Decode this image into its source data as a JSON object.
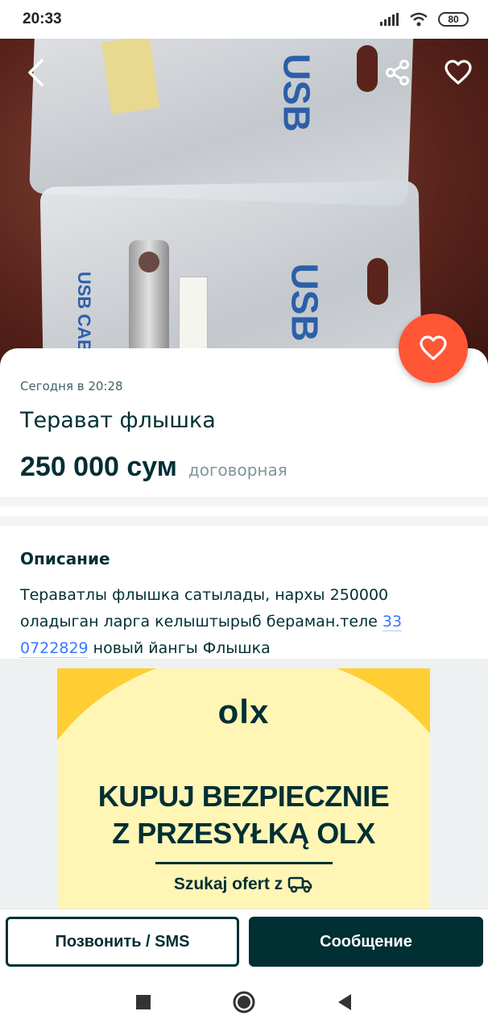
{
  "status_bar": {
    "time": "20:33",
    "battery": "80",
    "icons": [
      "signal-icon",
      "wifi-icon",
      "battery-icon"
    ]
  },
  "photo": {
    "description_icons": [
      "back-arrow-icon",
      "share-icon",
      "heart-outline-icon"
    ],
    "package_text": "USB",
    "package_text_2": "USB CABLE"
  },
  "listing": {
    "posted": "Сегодня в 20:28",
    "title": "Терават флышка",
    "price": "250 000 сум",
    "negotiable": "договорная"
  },
  "description": {
    "heading": "Описание",
    "text_before": "Тераватлы флышка сатылады, нархы 250000 оладыган ларга келыштырыб бераман.теле ",
    "phone": "33 0722829",
    "text_after": " новый йангы Флышка"
  },
  "ad": {
    "logo": "olx",
    "headline_1": "KUPUJ BEZPIECZNIE",
    "headline_2": "Z PRZESYŁKĄ OLX",
    "cta": "Szukaj ofert z"
  },
  "actions": {
    "call_label": "Позвонить / SMS",
    "message_label": "Сообщение"
  },
  "colors": {
    "brand_dark": "#002f34",
    "accent_orange": "#ff5636",
    "link_blue": "#3a77ff",
    "ad_yellow": "#ffce32"
  }
}
